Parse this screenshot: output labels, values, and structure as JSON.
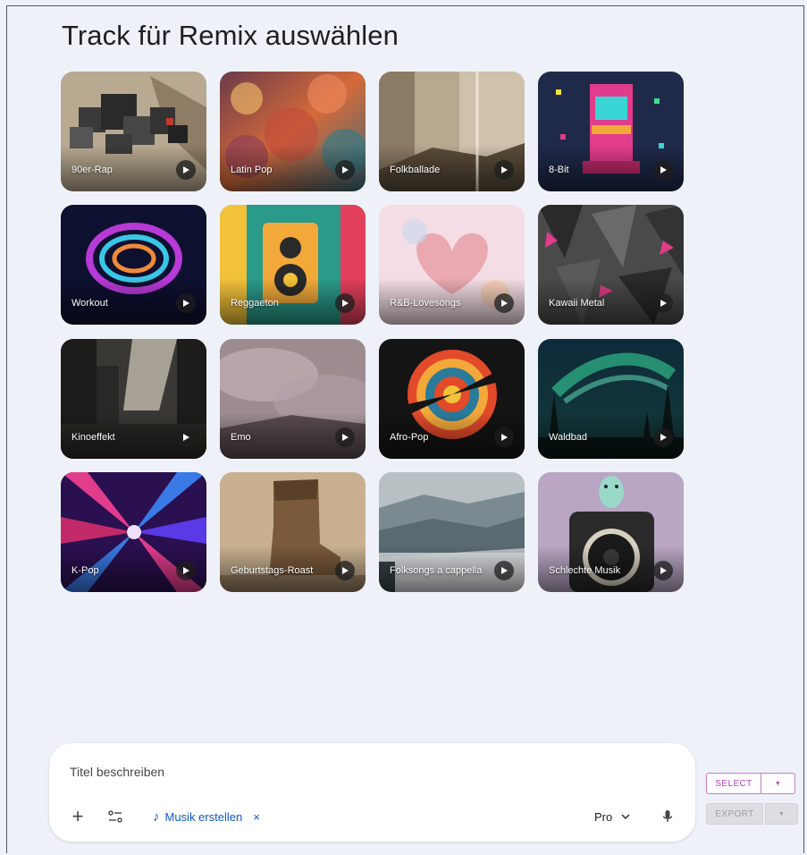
{
  "page_title": "Track für Remix auswählen",
  "tracks": [
    {
      "label": "90er-Rap"
    },
    {
      "label": "Latin Pop"
    },
    {
      "label": "Folkballade"
    },
    {
      "label": "8-Bit"
    },
    {
      "label": "Workout"
    },
    {
      "label": "Reggaeton"
    },
    {
      "label": "R&B-Lovesongs"
    },
    {
      "label": "Kawaii Metal"
    },
    {
      "label": "Kinoeffekt"
    },
    {
      "label": "Emo"
    },
    {
      "label": "Afro-Pop"
    },
    {
      "label": "Waldbad"
    },
    {
      "label": "K-Pop"
    },
    {
      "label": "Geburtstags-Roast"
    },
    {
      "label": "Folksongs a cappella"
    },
    {
      "label": "Schlechte Musik"
    }
  ],
  "composer": {
    "placeholder": "Titel beschreiben",
    "plus_icon": "+",
    "tool_chip_icon": "♪",
    "tool_chip_label": "Musik erstellen",
    "tool_chip_close": "×",
    "model_label": "Pro"
  },
  "side_buttons": {
    "select_label": "SELECT",
    "export_label": "EXPORT",
    "dropdown_glyph": "▼"
  },
  "colors": {
    "accent": "#0b57d0",
    "select_accent": "#b043b4",
    "background": "#eef2f8"
  }
}
